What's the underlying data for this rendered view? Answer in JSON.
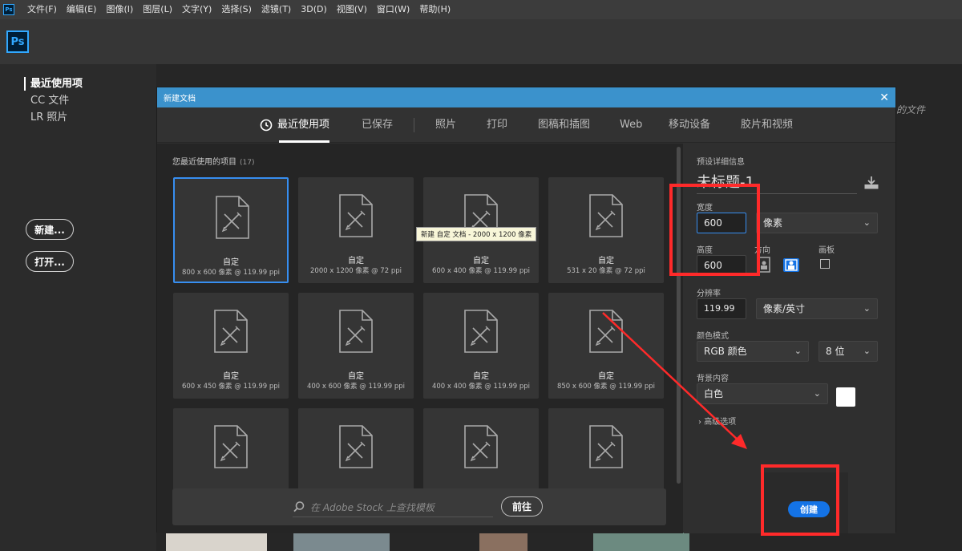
{
  "menubar": {
    "items": [
      "文件(F)",
      "编辑(E)",
      "图像(I)",
      "图层(L)",
      "文字(Y)",
      "选择(S)",
      "滤镜(T)",
      "3D(D)",
      "视图(V)",
      "窗口(W)",
      "帮助(H)"
    ]
  },
  "app": {
    "logo": "Ps"
  },
  "home": {
    "nav": [
      "最近使用项",
      "CC 文件",
      "LR 照片"
    ],
    "new_button": "新建...",
    "open_button": "打开...",
    "bg_recent_fragment": "的文件"
  },
  "dialog": {
    "title": "新建文档",
    "close": "✕",
    "tabs": [
      "最近使用项",
      "已保存",
      "照片",
      "打印",
      "图稿和插图",
      "Web",
      "移动设备",
      "胶片和视频"
    ],
    "recent_heading": "您最近使用的项目",
    "recent_count": "(17)",
    "tiles": [
      {
        "name": "自定",
        "meta": "800 x 600 像素 @ 119.99 ppi"
      },
      {
        "name": "自定",
        "meta": "2000 x 1200 像素 @ 72 ppi"
      },
      {
        "name": "自定",
        "meta": "600 x 400 像素 @ 119.99 ppi"
      },
      {
        "name": "自定",
        "meta": "531 x 20 像素 @ 72 ppi"
      },
      {
        "name": "自定",
        "meta": "600 x 450 像素 @ 119.99 ppi"
      },
      {
        "name": "自定",
        "meta": "400 x 600 像素 @ 119.99 ppi"
      },
      {
        "name": "自定",
        "meta": "400 x 400 像素 @ 119.99 ppi"
      },
      {
        "name": "自定",
        "meta": "850 x 600 像素 @ 119.99 ppi"
      },
      {
        "name": "",
        "meta": ""
      },
      {
        "name": "",
        "meta": ""
      },
      {
        "name": "",
        "meta": ""
      },
      {
        "name": "",
        "meta": ""
      }
    ],
    "tooltip": "新建 自定 文档 - 2000 x 1200 像素",
    "stock_placeholder": "在 Adobe Stock 上查找模板",
    "go_button": "前往",
    "preset": {
      "heading": "预设详细信息",
      "doc_name": "未标题-1",
      "width_label": "宽度",
      "width_value": "600",
      "width_unit": "像素",
      "height_label": "高度",
      "height_value": "600",
      "orientation_label": "方向",
      "artboard_label": "画板",
      "resolution_label": "分辨率",
      "resolution_value": "119.99",
      "resolution_unit": "像素/英寸",
      "color_mode_label": "颜色模式",
      "color_mode": "RGB 颜色",
      "bit_depth": "8 位",
      "background_label": "背景内容",
      "background": "白色",
      "advanced": "高级选项",
      "create_button": "创建"
    }
  },
  "colors": {
    "accent": "#1473e6",
    "titlebar": "#3b92cc",
    "annotation": "#ff2a2a"
  }
}
